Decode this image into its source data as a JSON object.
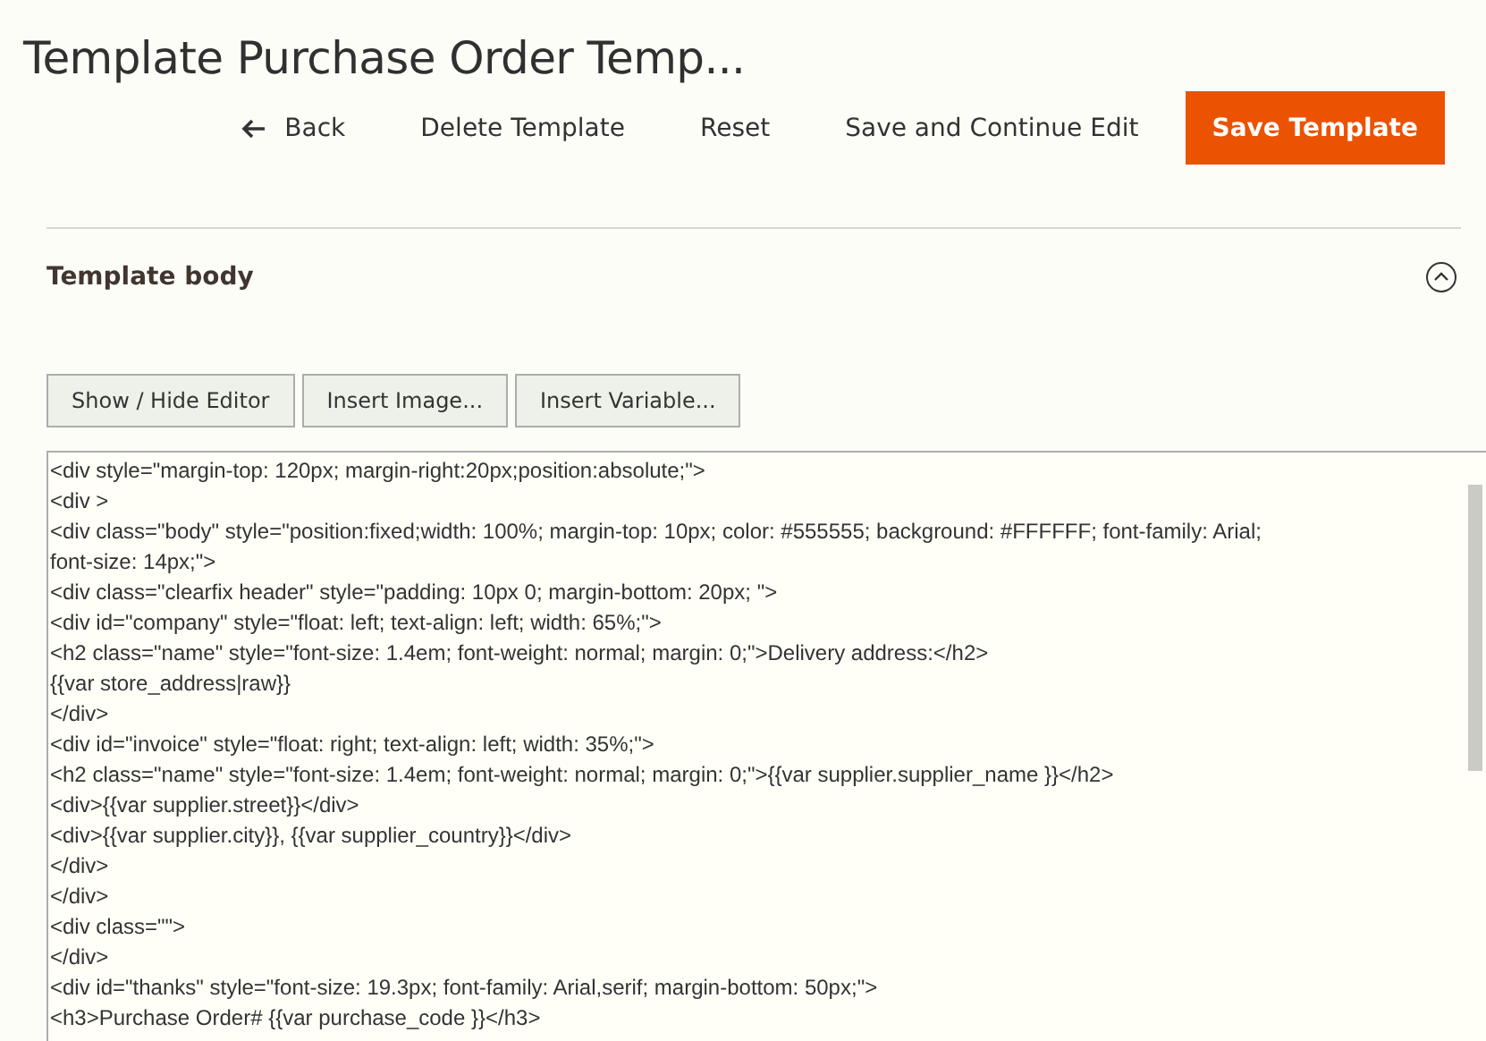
{
  "page_title": "Template Purchase Order Temp...",
  "actions": [
    {
      "label": "Back",
      "kind": "back"
    },
    {
      "label": "Delete Template",
      "kind": "link"
    },
    {
      "label": "Reset",
      "kind": "link"
    },
    {
      "label": "Save and Continue Edit",
      "kind": "link"
    },
    {
      "label": "Save Template",
      "kind": "primary"
    }
  ],
  "section": {
    "title": "Template body",
    "expanded": true
  },
  "editor_buttons": [
    "Show / Hide Editor",
    "Insert Image...",
    "Insert Variable..."
  ],
  "code_lines": [
    "<div style=\"margin-top: 120px; margin-right:20px;position:absolute;\">",
    "<div >",
    "<div class=\"body\" style=\"position:fixed;width: 100%;  margin-top: 10px; color: #555555; background: #FFFFFF; font-family: Arial;",
    "font-size: 14px;\">",
    "<div class=\"clearfix header\" style=\"padding: 10px 0; margin-bottom: 20px; \">",
    "<div id=\"company\" style=\"float: left; text-align: left; width: 65%;\">",
    "<h2 class=\"name\" style=\"font-size: 1.4em; font-weight: normal; margin: 0;\">Delivery address:</h2>",
    "{{var store_address|raw}}",
    "</div>",
    "<div id=\"invoice\" style=\"float: right; text-align: left; width: 35%;\">",
    "<h2 class=\"name\" style=\"font-size: 1.4em; font-weight: normal; margin: 0;\">{{var supplier.supplier_name }}</h2>",
    "<div>{{var supplier.street}}</div>",
    "<div>{{var supplier.city}}, {{var supplier_country}}</div>",
    "</div>",
    "</div>",
    "<div class=\"\">",
    "</div>",
    "<div id=\"thanks\" style=\"font-size: 19.3px; font-family: Arial,serif; margin-bottom: 50px;\">",
    "<h3>Purchase Order# {{var purchase_code }}</h3>"
  ]
}
